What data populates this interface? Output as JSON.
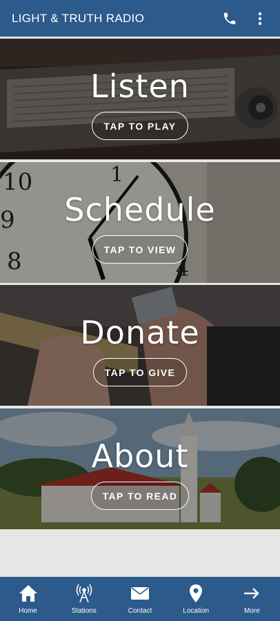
{
  "app": {
    "title": "LIGHT & TRUTH RADIO"
  },
  "header": {
    "phone_icon": "phone-icon",
    "more_icon": "more-vert-icon"
  },
  "tiles": [
    {
      "title": "Listen",
      "button": "TAP TO PLAY",
      "image": "vintage-radio"
    },
    {
      "title": "Schedule",
      "button": "TAP TO VIEW",
      "image": "wall-clock"
    },
    {
      "title": "Donate",
      "button": "TAP TO GIVE",
      "image": "hands-with-card"
    },
    {
      "title": "About",
      "button": "TAP TO READ",
      "image": "country-church"
    }
  ],
  "tabs": [
    {
      "label": "Home",
      "icon": "home-icon"
    },
    {
      "label": "Stations",
      "icon": "antenna-icon"
    },
    {
      "label": "Contact",
      "icon": "envelope-icon"
    },
    {
      "label": "Location",
      "icon": "map-pin-icon"
    },
    {
      "label": "More",
      "icon": "arrow-right-icon"
    }
  ],
  "colors": {
    "brand": "#2c5a8a",
    "background": "#e6e6e6"
  }
}
